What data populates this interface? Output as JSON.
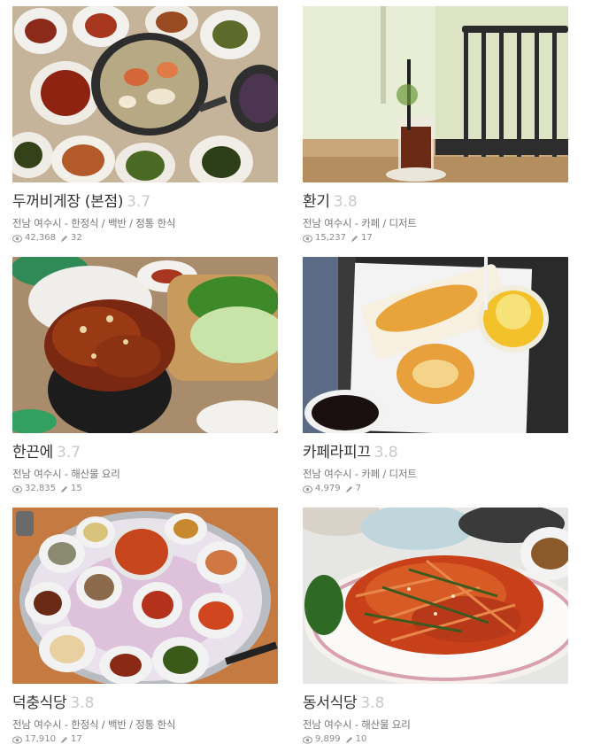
{
  "cards": [
    {
      "name": "두꺼비게장 (본점)",
      "rating": "3.7",
      "region": "전남 여수시 - 한정식 / 백반 / 정통 한식",
      "views": "42,368",
      "reviews": "32"
    },
    {
      "name": "환기",
      "rating": "3.8",
      "region": "전남 여수시 - 카페 / 디저트",
      "views": "15,237",
      "reviews": "17"
    },
    {
      "name": "한끈에",
      "rating": "3.7",
      "region": "전남 여수시 - 해산물 요리",
      "views": "32,835",
      "reviews": "15"
    },
    {
      "name": "카페라피끄",
      "rating": "3.8",
      "region": "전남 여수시 - 카페 / 디저트",
      "views": "4,979",
      "reviews": "7"
    },
    {
      "name": "덕충식당",
      "rating": "3.8",
      "region": "전남 여수시 - 한정식 / 백반 / 정통 한식",
      "views": "17,910",
      "reviews": "17"
    },
    {
      "name": "동서식당",
      "rating": "3.8",
      "region": "전남 여수시 - 해산물 요리",
      "views": "9,899",
      "reviews": "10"
    }
  ],
  "icons": {
    "views": "eye-icon",
    "reviews": "pencil-icon"
  }
}
